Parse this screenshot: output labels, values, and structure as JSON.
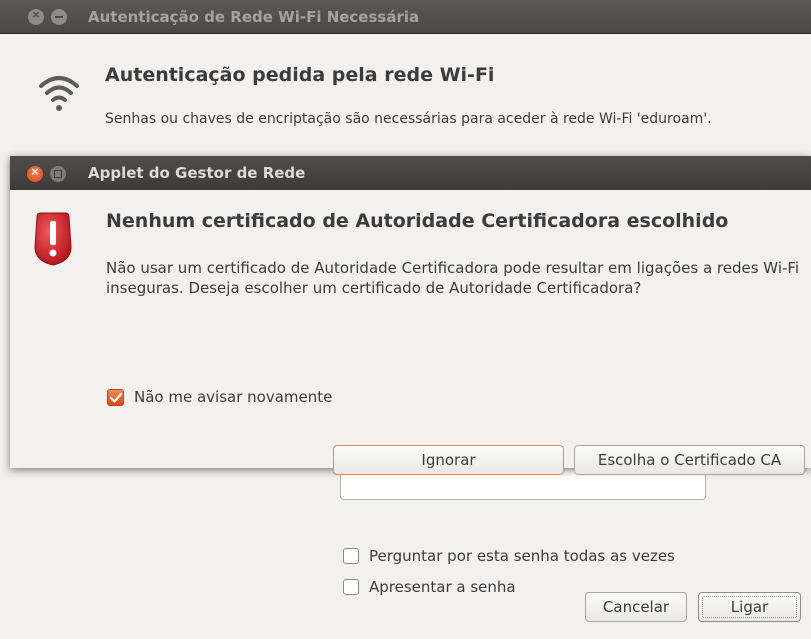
{
  "background_dialog": {
    "title": "Autenticação de Rede Wi-Fi Necessária",
    "heading": "Autenticação pedida pela rede Wi-Fi",
    "message": "Senhas ou chaves de encriptação são necessárias para aceder à rede Wi-Fi 'eduroam'.",
    "checkbox_ask_password": "Perguntar por esta senha todas as vezes",
    "checkbox_show_password": "Apresentar a senha",
    "cancel_label": "Cancelar",
    "connect_label": "Ligar",
    "window_close_glyph": "×"
  },
  "foreground_dialog": {
    "title": "Applet do Gestor de Rede",
    "heading": "Nenhum certificado de Autoridade Certificadora escolhido",
    "message": "Não usar um certificado de Autoridade Certificadora pode resultar em ligações a redes Wi-Fi inseguras.  Deseja escolher um certificado de Autoridade Certificadora?",
    "checkbox_dont_warn": "Não me avisar novamente",
    "checkbox_dont_warn_checked": true,
    "ignore_label": "Ignorar",
    "choose_ca_label": "Escolha o Certificado CA",
    "window_close_glyph": "×"
  },
  "colors": {
    "accent": "#dd4814",
    "error_red": "#c7162b",
    "titlebar": "#3c3b37"
  }
}
